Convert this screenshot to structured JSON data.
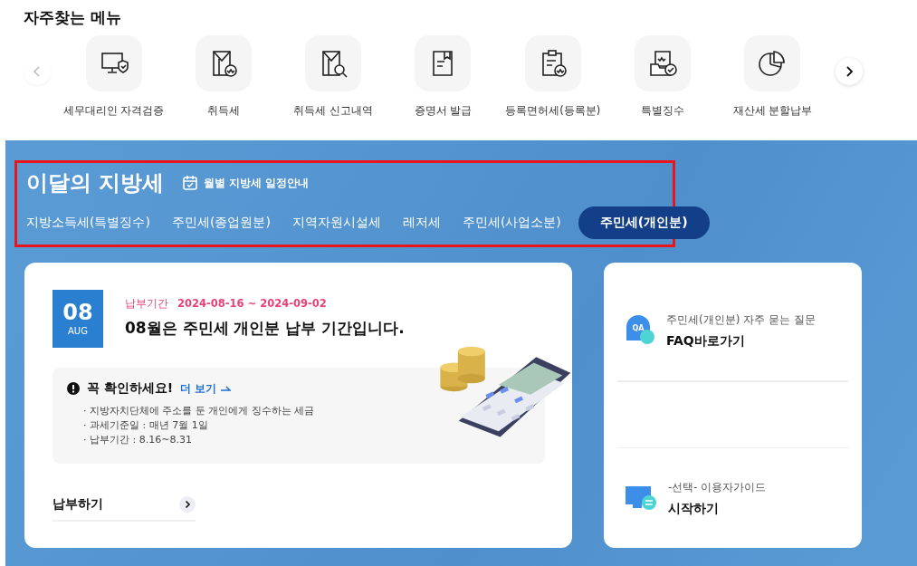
{
  "quick_menu": {
    "title": "자주찾는 메뉴",
    "prev_disabled": true,
    "items": [
      {
        "kind": "monitor-shield",
        "label": "세무대리인 자격검증"
      },
      {
        "kind": "envelope-won",
        "label": "취득세"
      },
      {
        "kind": "envelope-search",
        "label": "취득세 신고내역"
      },
      {
        "kind": "document",
        "label": "증명서 발급"
      },
      {
        "kind": "clipboard-won",
        "label": "등록면허세(등록분)"
      },
      {
        "kind": "tray-check",
        "label": "특별징수"
      },
      {
        "kind": "pie",
        "label": "재산세 분할납부"
      }
    ]
  },
  "monthly": {
    "title": "이달의 지방세",
    "schedule_link": "월별 지방세 일정안내",
    "highlighted": true,
    "tabs": [
      {
        "label": "지방소득세(특별징수)",
        "selected": false
      },
      {
        "label": "주민세(종업원분)",
        "selected": false
      },
      {
        "label": "지역자원시설세",
        "selected": false
      },
      {
        "label": "레저세",
        "selected": false
      },
      {
        "label": "주민세(사업소분)",
        "selected": false
      },
      {
        "label": "주민세(개인분)",
        "selected": true
      }
    ]
  },
  "detail": {
    "month": "08",
    "month_abbr": "AUG",
    "period_label": "납부기간",
    "period": "2024-08-16 ~ 2024-09-02",
    "headline": "08월은 주민세 개인분 납부 기간입니다.",
    "notice_title": "꼭 확인하세요!",
    "more_link": "더 보기",
    "notes": [
      "· 지방자치단체에 주소를 둔 개인에게 징수하는 세금",
      "· 과세기준일 : 매년 7월 1일",
      "· 납부기간 : 8.16~8.31"
    ],
    "pay_link": "납부하기"
  },
  "side_links": [
    {
      "kind": "faq",
      "icon_text": "QA",
      "caption": "주민세(개인분) 자주 묻는 질문",
      "action": "FAQ바로가기"
    },
    {
      "kind": "guide",
      "caption": "-선택- 이용자가이드",
      "action": "시작하기"
    }
  ]
}
